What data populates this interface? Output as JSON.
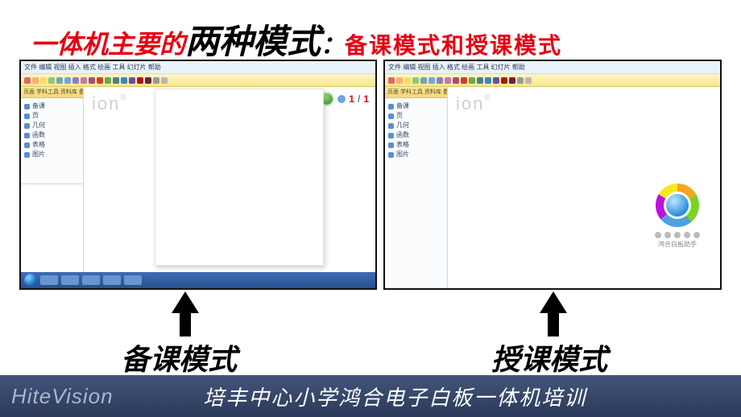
{
  "title": {
    "part1_red": "一体机主要的",
    "part2_black": "两种模式",
    "colon": "：",
    "part3_red": "备课模式和授课模式"
  },
  "screenshot_left": {
    "menubar": "文件 编辑 视图 插入 格式 绘画 工具 幻灯片 帮助",
    "side_tabs": "页面 学科工具 资料库 备注",
    "tree_items": [
      "备课",
      "页",
      "几何",
      "函数",
      "表格",
      "图片"
    ],
    "watermark": "ion",
    "watermark_reg": "®",
    "page_indicator": {
      "current": "1",
      "sep": "/",
      "total": "1"
    }
  },
  "screenshot_right": {
    "menubar": "文件 编辑 视图 插入 格式 绘画 工具 幻灯片 帮助",
    "side_tabs": "页面 学科工具 资料库 备注",
    "tree_items": [
      "备课",
      "页",
      "几何",
      "函数",
      "表格",
      "图片"
    ],
    "watermark": "ion",
    "watermark_reg": "®",
    "widget_caption": "鸿合白板助手"
  },
  "captions": {
    "left": "备课模式",
    "right": "授课模式"
  },
  "footer": {
    "brand": "HiteVision",
    "subtitle": "培丰中心小学鸿合电子白板一体机培训"
  },
  "toolbar_colors": [
    "#e06666",
    "#f6b26b",
    "#ffd966",
    "#93c47d",
    "#76a5af",
    "#6fa8dc",
    "#8e7cc3",
    "#c27ba0",
    "#a64d79",
    "#cc4125",
    "#6aa84f",
    "#45818e",
    "#3d85c6",
    "#674ea7",
    "#a61c00",
    "#741b47",
    "#999999",
    "#b7b7b7"
  ]
}
